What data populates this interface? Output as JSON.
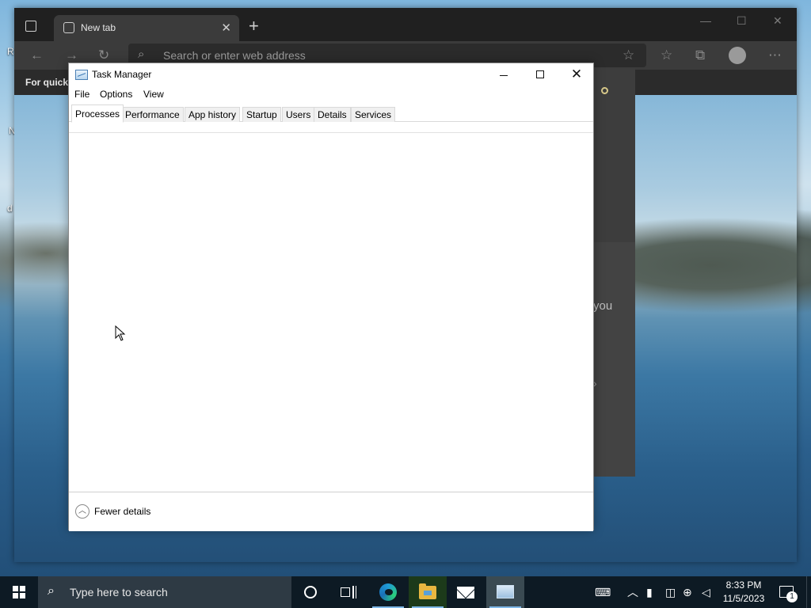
{
  "desktop": {
    "edge_labels": [
      "R",
      "N",
      "d"
    ]
  },
  "edge": {
    "tab_title": "New tab",
    "tab_close": "✕",
    "new_tab_glyph": "+",
    "minimize_glyph": "—",
    "maximize_glyph": "☐",
    "close_glyph": "✕",
    "address_placeholder": "Search or enter web address",
    "favorites_bar_text": "For quick",
    "side_panel_text": "you",
    "side_panel_chevron": "›"
  },
  "task_manager": {
    "title": "Task Manager",
    "menu": [
      "File",
      "Options",
      "View"
    ],
    "tabs": [
      "Processes",
      "Performance",
      "App history",
      "Startup",
      "Users",
      "Details",
      "Services"
    ],
    "active_tab": "Processes",
    "footer_label": "Fewer details",
    "footer_icon_glyph": "︿"
  },
  "taskbar": {
    "search_placeholder": "Type here to search",
    "time": "8:33 PM",
    "date": "11/5/2023",
    "notification_count": "1"
  },
  "icons": {
    "start": "windows-start-icon",
    "search": "search-icon",
    "cortana": "cortana-icon",
    "task_view": "task-view-icon",
    "edge": "edge-browser-icon",
    "file_explorer": "file-explorer-icon",
    "mail": "mail-icon",
    "task_manager": "task-manager-icon"
  },
  "colors": {
    "taskbar": "#0d1a24",
    "edge_chrome": "#202020",
    "active_indicator": "#7fb8e8"
  }
}
